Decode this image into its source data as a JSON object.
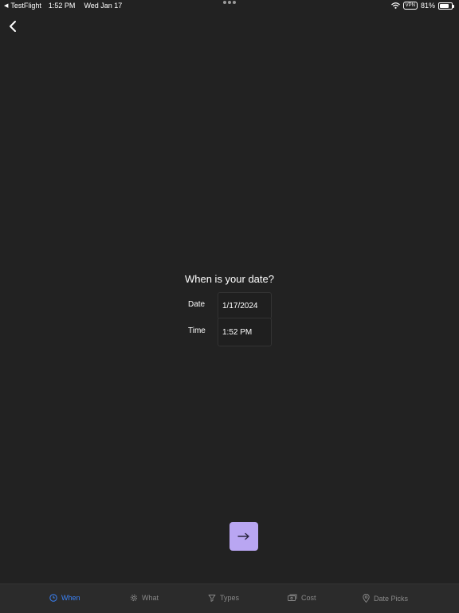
{
  "status_bar": {
    "app": "TestFlight",
    "time": "1:52 PM",
    "date": "Wed Jan 17",
    "vpn": "VPN",
    "battery": "81%",
    "battery_level": 0.81
  },
  "nav": {
    "back_icon": "chevron-left-icon"
  },
  "form": {
    "title": "When is your date?",
    "date_label": "Date",
    "date_value": "1/17/2024",
    "time_label": "Time",
    "time_value": "1:52 PM"
  },
  "next_button": {
    "icon": "arrow-right-icon"
  },
  "tabs": [
    {
      "label": "When",
      "icon": "clock-icon",
      "active": true
    },
    {
      "label": "What",
      "icon": "gear-icon",
      "active": false
    },
    {
      "label": "Types",
      "icon": "filter-icon",
      "active": false
    },
    {
      "label": "Cost",
      "icon": "money-icon",
      "active": false
    },
    {
      "label": "Date Picks",
      "icon": "pin-icon",
      "active": false
    }
  ],
  "colors": {
    "background": "#222222",
    "accent": "#3b82f6",
    "button": "#b9a6f2",
    "tab_inactive": "#8a8a8a"
  }
}
